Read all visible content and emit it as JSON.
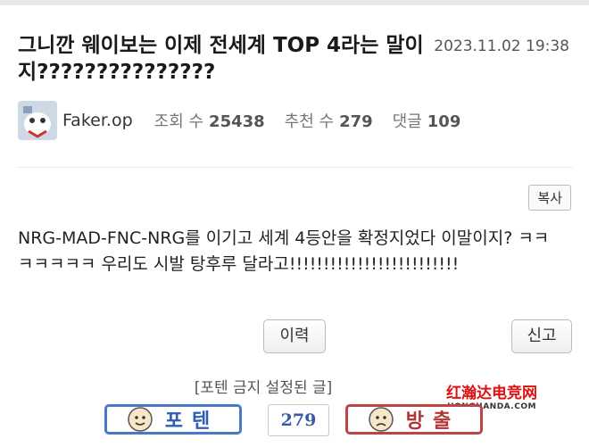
{
  "post": {
    "title": "그니깐 웨이보는 이제 전세계 TOP 4라는 말이지???????????????",
    "date": "2023.11.02 19:38",
    "author": "Faker.op",
    "body": "NRG-MAD-FNC-NRG를 이기고 세계 4등안을 확정지었다 이말이지? ㅋㅋㅋㅋㅋㅋㅋ 우리도 시발 탕후루 달라고!!!!!!!!!!!!!!!!!!!!!!!!!"
  },
  "stats": {
    "views_label": "조회 수",
    "views": "25438",
    "recommend_label": "추천 수",
    "recommend": "279",
    "comments_label": "댓글",
    "comments": "109"
  },
  "actions": {
    "copy_label": "복사",
    "history_label": "이력",
    "report_label": "신고",
    "notice": "[포텐 금지 설정된 글]",
    "upvote_label": "포텐",
    "downvote_label": "방출",
    "vote_count": "279"
  },
  "watermark": {
    "line1": "红瀚达电竞网",
    "line2": "HONGHANDA.COM"
  },
  "colors": {
    "upvote": "#4a78c8",
    "downvote": "#c04444"
  },
  "icons": {
    "upvote": "thumbs-up-icon",
    "downvote": "thumbs-down-icon"
  }
}
